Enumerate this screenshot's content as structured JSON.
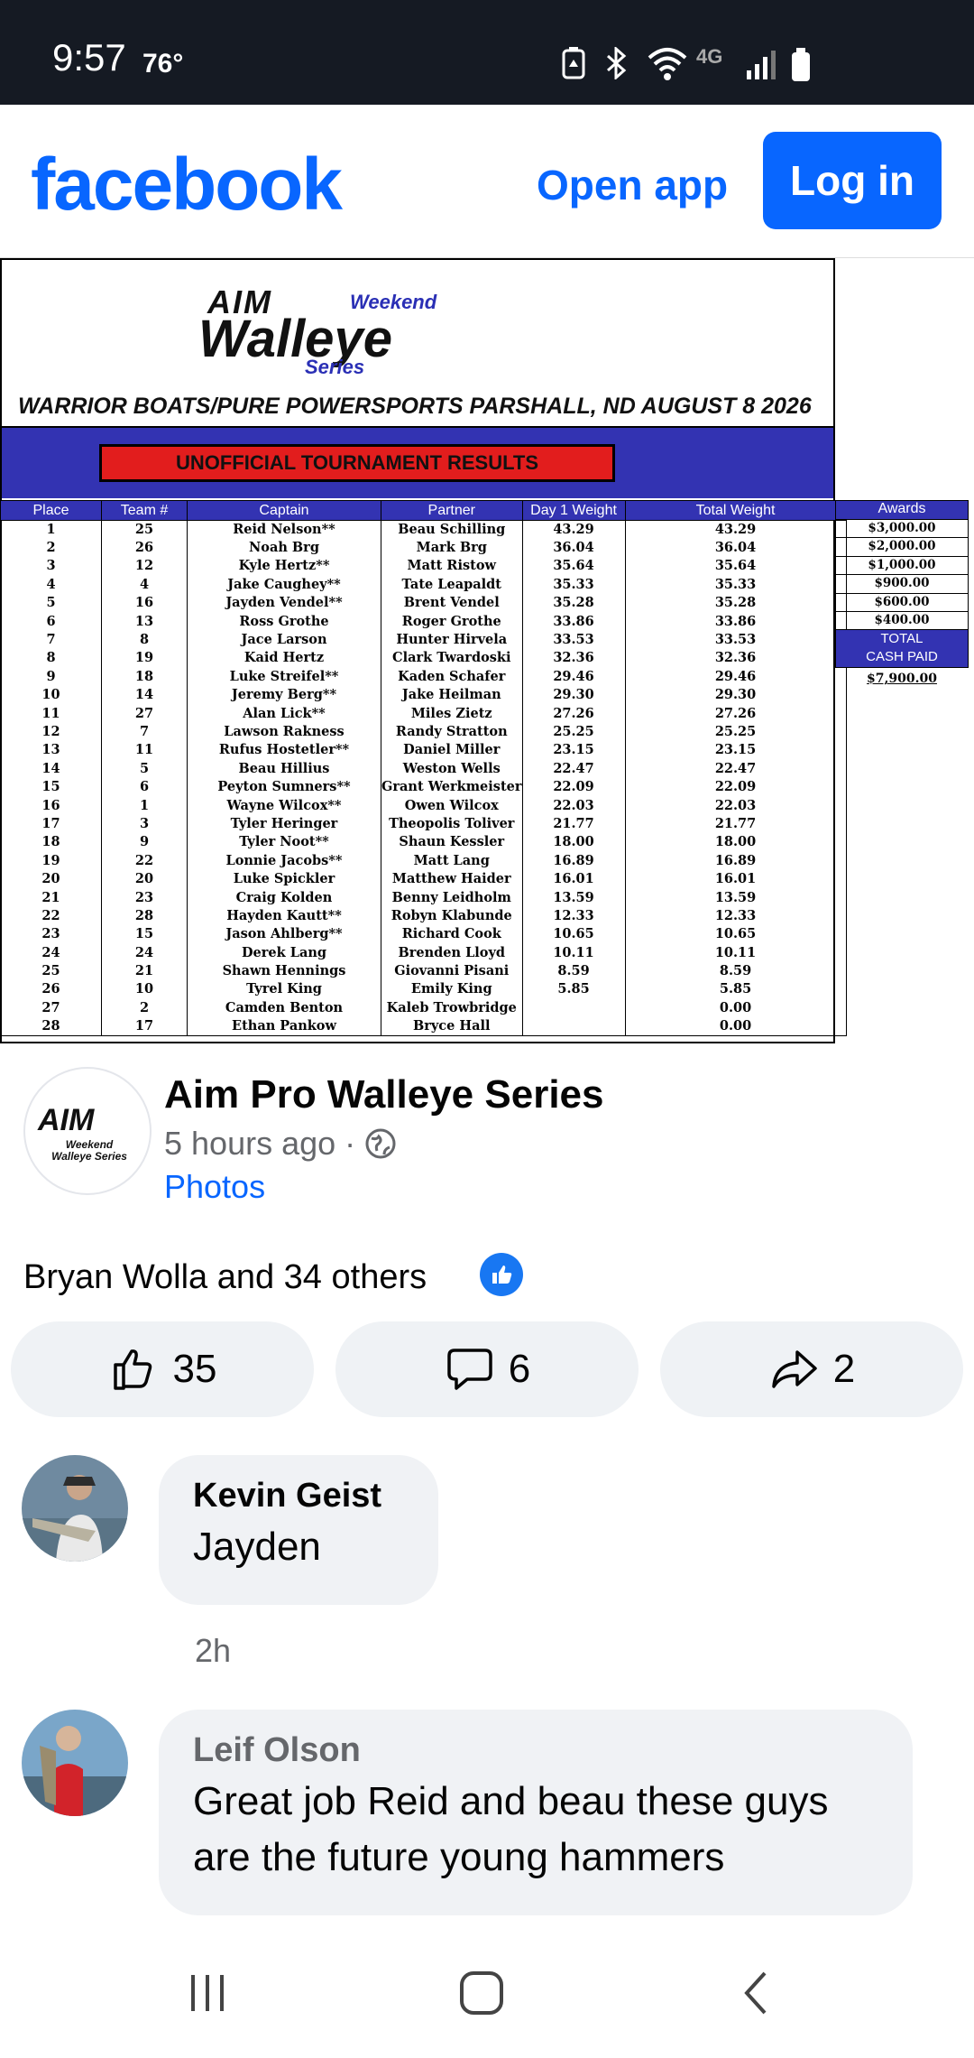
{
  "status_bar": {
    "time": "9:57",
    "temp": "76°",
    "network": "4G"
  },
  "header": {
    "logo": "facebook",
    "open_app": "Open app",
    "login": "Log in"
  },
  "results_image": {
    "logo_brand": "AIM",
    "logo_weekend": "Weekend",
    "logo_walleye": "Walleye",
    "logo_series": "Series",
    "event_title": "WARRIOR BOATS/PURE POWERSPORTS PARSHALL, ND AUGUST 8 2026",
    "banner": "UNOFFICIAL TOURNAMENT RESULTS",
    "columns": [
      "Place",
      "Team #",
      "Captain",
      "Partner",
      "Day 1 Weight",
      "Total Weight"
    ],
    "rows": [
      [
        "1",
        "25",
        "Reid Nelson**",
        "Beau Schilling",
        "43.29",
        "43.29"
      ],
      [
        "2",
        "26",
        "Noah Brg",
        "Mark Brg",
        "36.04",
        "36.04"
      ],
      [
        "3",
        "12",
        "Kyle Hertz**",
        "Matt Ristow",
        "35.64",
        "35.64"
      ],
      [
        "4",
        "4",
        "Jake Caughey**",
        "Tate Leapaldt",
        "35.33",
        "35.33"
      ],
      [
        "5",
        "16",
        "Jayden Vendel**",
        "Brent Vendel",
        "35.28",
        "35.28"
      ],
      [
        "6",
        "13",
        "Ross Grothe",
        "Roger Grothe",
        "33.86",
        "33.86"
      ],
      [
        "7",
        "8",
        "Jace Larson",
        "Hunter Hirvela",
        "33.53",
        "33.53"
      ],
      [
        "8",
        "19",
        "Kaid Hertz",
        "Clark Twardoski",
        "32.36",
        "32.36"
      ],
      [
        "9",
        "18",
        "Luke Streifel**",
        "Kaden Schafer",
        "29.46",
        "29.46"
      ],
      [
        "10",
        "14",
        "Jeremy Berg**",
        "Jake Heilman",
        "29.30",
        "29.30"
      ],
      [
        "11",
        "27",
        "Alan Lick**",
        "Miles Zietz",
        "27.26",
        "27.26"
      ],
      [
        "12",
        "7",
        "Lawson Rakness",
        "Randy Stratton",
        "25.25",
        "25.25"
      ],
      [
        "13",
        "11",
        "Rufus Hostetler**",
        "Daniel Miller",
        "23.15",
        "23.15"
      ],
      [
        "14",
        "5",
        "Beau Hillius",
        "Weston Wells",
        "22.47",
        "22.47"
      ],
      [
        "15",
        "6",
        "Peyton Sumners**",
        "Grant Werkmeister",
        "22.09",
        "22.09"
      ],
      [
        "16",
        "1",
        "Wayne Wilcox**",
        "Owen Wilcox",
        "22.03",
        "22.03"
      ],
      [
        "17",
        "3",
        "Tyler Heringer",
        "Theopolis Toliver",
        "21.77",
        "21.77"
      ],
      [
        "18",
        "9",
        "Tyler Noot**",
        "Shaun Kessler",
        "18.00",
        "18.00"
      ],
      [
        "19",
        "22",
        "Lonnie Jacobs**",
        "Matt Lang",
        "16.89",
        "16.89"
      ],
      [
        "20",
        "20",
        "Luke Spickler",
        "Matthew Haider",
        "16.01",
        "16.01"
      ],
      [
        "21",
        "23",
        "Craig Kolden",
        "Benny Leidholm",
        "13.59",
        "13.59"
      ],
      [
        "22",
        "28",
        "Hayden Kautt**",
        "Robyn Klabunde",
        "12.33",
        "12.33"
      ],
      [
        "23",
        "15",
        "Jason Ahlberg**",
        "Richard Cook",
        "10.65",
        "10.65"
      ],
      [
        "24",
        "24",
        "Derek Lang",
        "Brenden Lloyd",
        "10.11",
        "10.11"
      ],
      [
        "25",
        "21",
        "Shawn Hennings",
        "Giovanni Pisani",
        "8.59",
        "8.59"
      ],
      [
        "26",
        "10",
        "Tyrel King",
        "Emily King",
        "5.85",
        "5.85"
      ],
      [
        "27",
        "2",
        "Camden Benton",
        "Kaleb Trowbridge",
        "",
        "0.00"
      ],
      [
        "28",
        "17",
        "Ethan Pankow",
        "Bryce Hall",
        "",
        "0.00"
      ]
    ],
    "awards_header": "Awards",
    "awards": [
      "$3,000.00",
      "$2,000.00",
      "$1,000.00",
      "$900.00",
      "$600.00",
      "$400.00"
    ],
    "total_label_1": "TOTAL",
    "total_label_2": "CASH PAID",
    "total_paid": "$7,900.00"
  },
  "post": {
    "avatar_brand": "AIM",
    "avatar_sub_1": "Weekend",
    "avatar_sub_2": "Walleye Series",
    "page_name": "Aim Pro Walleye Series",
    "time": "5 hours ago ·",
    "photos_link": "Photos",
    "reactions_text": "Bryan Wolla and 34 others",
    "like_count": "35",
    "comment_count": "6",
    "share_count": "2"
  },
  "comments": [
    {
      "name": "Kevin Geist",
      "text": "Jayden",
      "time": "2h"
    },
    {
      "name": "Leif Olson",
      "text_line_1": "Great job Reid and beau these guys",
      "text_line_2": "are the future young hammers"
    }
  ]
}
